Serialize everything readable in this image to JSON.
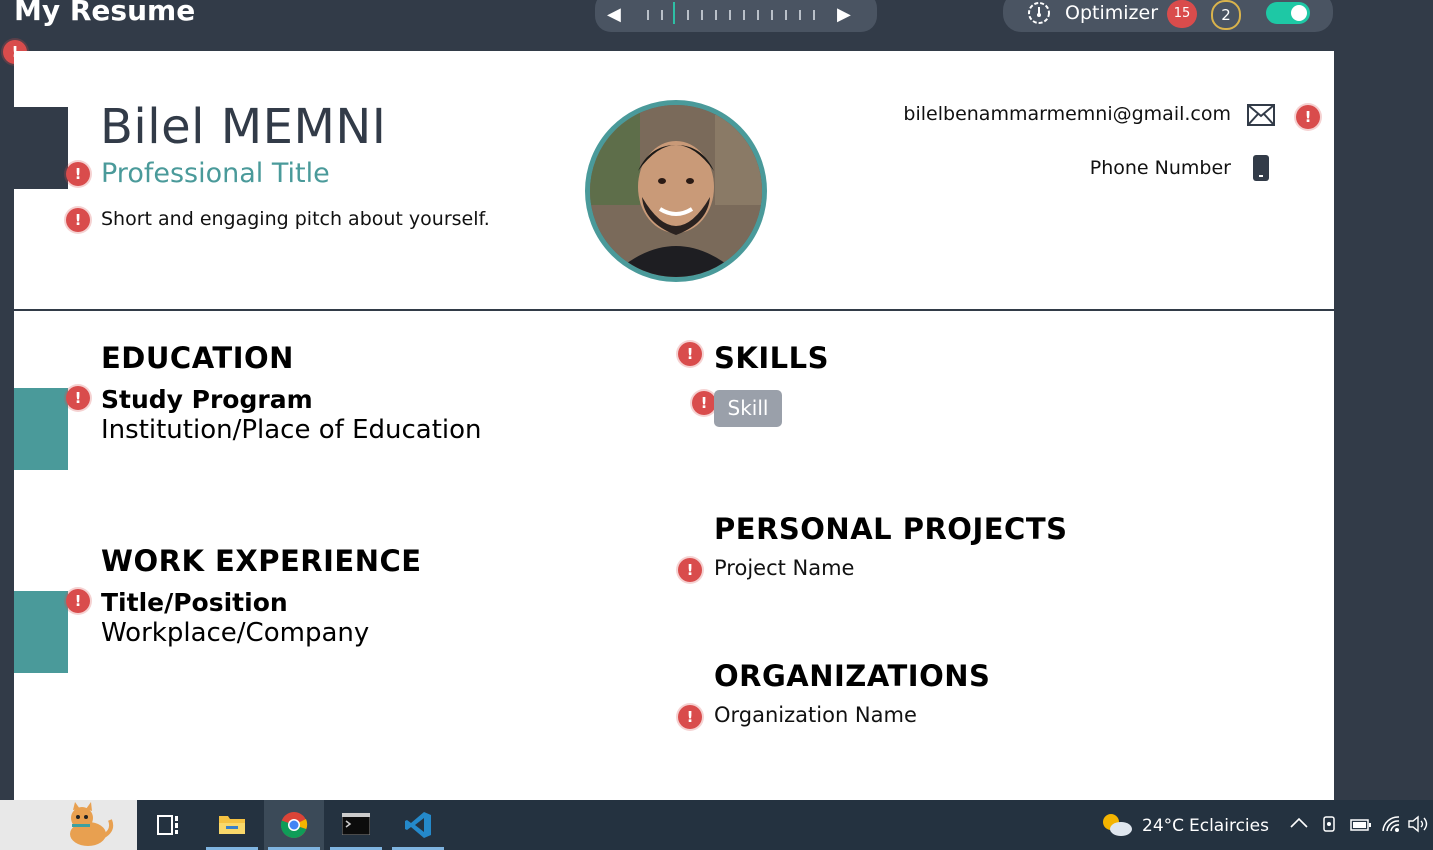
{
  "app": {
    "title": "My Resume"
  },
  "pager": {
    "prev": "◀",
    "next": "▶"
  },
  "optimizer": {
    "label": "Optimizer",
    "error_count": "15",
    "warning_count": "2",
    "enabled": true
  },
  "warning_glyph": "!",
  "resume": {
    "name": "Bilel MEMNI",
    "professional_title": "Professional Title",
    "pitch": "Short and engaging pitch about yourself.",
    "email": "bilelbenammarmemni@gmail.com",
    "phone": "Phone Number",
    "sections": {
      "education": {
        "title": "EDUCATION",
        "study_program": "Study Program",
        "institution": "Institution/Place of Education"
      },
      "work": {
        "title": "WORK EXPERIENCE",
        "position": "Title/Position",
        "company": "Workplace/Company"
      },
      "skills": {
        "title": "SKILLS",
        "items": [
          "Skill"
        ]
      },
      "projects": {
        "title": "PERSONAL PROJECTS",
        "item": "Project Name"
      },
      "organizations": {
        "title": "ORGANIZATIONS",
        "item": "Organization Name"
      }
    }
  },
  "colors": {
    "accent_teal": "#4a9a9a",
    "dark": "#323b48",
    "error": "#d94c4c",
    "toggle_on": "#1ec8a5"
  },
  "taskbar": {
    "apps": [
      "cat-app-icon",
      "task-view-icon",
      "file-explorer-icon",
      "chrome-icon",
      "terminal-icon",
      "vscode-icon"
    ],
    "weather_temp": "24°C",
    "weather_desc": "Eclaircies"
  }
}
